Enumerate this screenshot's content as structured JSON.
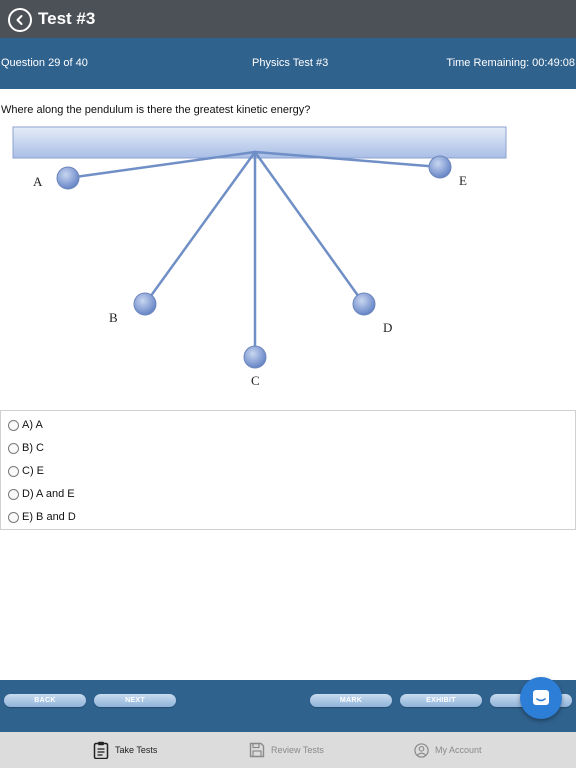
{
  "header": {
    "title": "Test #3",
    "back_icon": "chevron-left-circle-icon"
  },
  "info_bar": {
    "question_progress": "Question 29 of 40",
    "test_name": "Physics Test #3",
    "time_remaining": "Time Remaining: 00:49:08"
  },
  "question": {
    "text": "Where along the pendulum is there the greatest kinetic energy?"
  },
  "diagram": {
    "labels": {
      "a": "A",
      "b": "B",
      "c": "C",
      "d": "D",
      "e": "E"
    }
  },
  "answers": [
    {
      "label": "A) A"
    },
    {
      "label": "B) C"
    },
    {
      "label": "C) E"
    },
    {
      "label": "D) A and E"
    },
    {
      "label": "E) B and D"
    }
  ],
  "actions": {
    "back": "BACK",
    "next": "NEXT",
    "mark": "MARK",
    "exhibit": "EXHIBIT",
    "partial": "R"
  },
  "tabs": [
    {
      "label": "Take Tests",
      "icon": "clipboard-icon",
      "active": true
    },
    {
      "label": "Review Tests",
      "icon": "save-disk-icon",
      "active": false
    },
    {
      "label": "My Account",
      "icon": "user-circle-icon",
      "active": false
    }
  ],
  "colors": {
    "header_bg": "#4c5057",
    "info_bar_bg": "#30628e",
    "accent": "#2d7ed6",
    "tab_active": "#222222",
    "tab_inactive": "#8a8a8a"
  }
}
